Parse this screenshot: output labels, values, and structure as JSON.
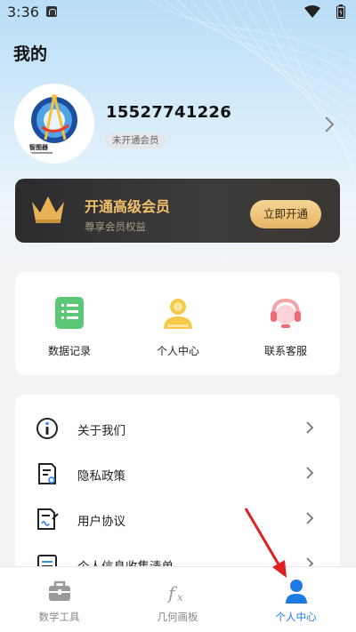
{
  "status_bar": {
    "time": "3:36"
  },
  "page": {
    "title": "我的"
  },
  "profile": {
    "phone": "15527741226",
    "membership_status": "未开通会员",
    "avatar_logo_text": "智图器"
  },
  "vip": {
    "title": "开通高级会员",
    "subtitle": "尊享会员权益",
    "button_label": "立即开通",
    "accent_color": "#f0c16a"
  },
  "quick_actions": [
    {
      "label": "数据记录",
      "icon": "data-record-icon"
    },
    {
      "label": "个人中心",
      "icon": "personal-center-icon"
    },
    {
      "label": "联系客服",
      "icon": "customer-service-icon"
    }
  ],
  "menu": [
    {
      "label": "关于我们",
      "icon": "info-icon"
    },
    {
      "label": "隐私政策",
      "icon": "privacy-document-icon"
    },
    {
      "label": "用户协议",
      "icon": "agreement-document-icon"
    },
    {
      "label": "个人信息收集清单",
      "icon": "list-document-icon"
    }
  ],
  "bottom_nav": [
    {
      "label": "数学工具",
      "icon": "toolbox-icon",
      "active": false
    },
    {
      "label": "几何画板",
      "icon": "fx-icon",
      "active": false
    },
    {
      "label": "个人中心",
      "icon": "person-icon",
      "active": true
    }
  ],
  "colors": {
    "active": "#1e7be5",
    "annotation_arrow": "#e02020"
  }
}
